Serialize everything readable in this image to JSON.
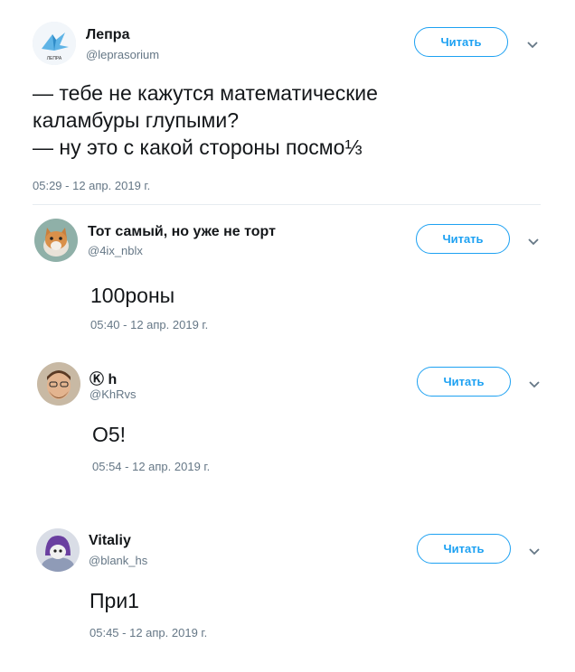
{
  "tweets": [
    {
      "name": "Лепра",
      "handle": "@leprasorium",
      "follow_label": "Читать",
      "text": "— тебе не кажутся математические\nкаламбуры глупыми?\n— ну это с какой стороны посмо⅓",
      "time": "05:29 - 12 апр. 2019 г.",
      "avatar_text": "ЛЕПРА"
    },
    {
      "name": "Тот самый, но уже не торт",
      "handle": "@4ix_nblx",
      "follow_label": "Читать",
      "text": "100роны",
      "time": "05:40 - 12 апр. 2019 г."
    },
    {
      "name": "Ⓚ һ",
      "handle": "@KhRvs",
      "follow_label": "Читать",
      "text": "О5!",
      "time": "05:54 - 12 апр. 2019 г."
    },
    {
      "name": "Vitaliy",
      "handle": "@blank_hs",
      "follow_label": "Читать",
      "text": "При1",
      "time": "05:45 - 12 апр. 2019 г."
    }
  ],
  "colors": {
    "accent": "#1da1f2",
    "muted": "#657786",
    "text": "#14171a"
  },
  "icons": {
    "menu": "chevron-down-icon"
  }
}
